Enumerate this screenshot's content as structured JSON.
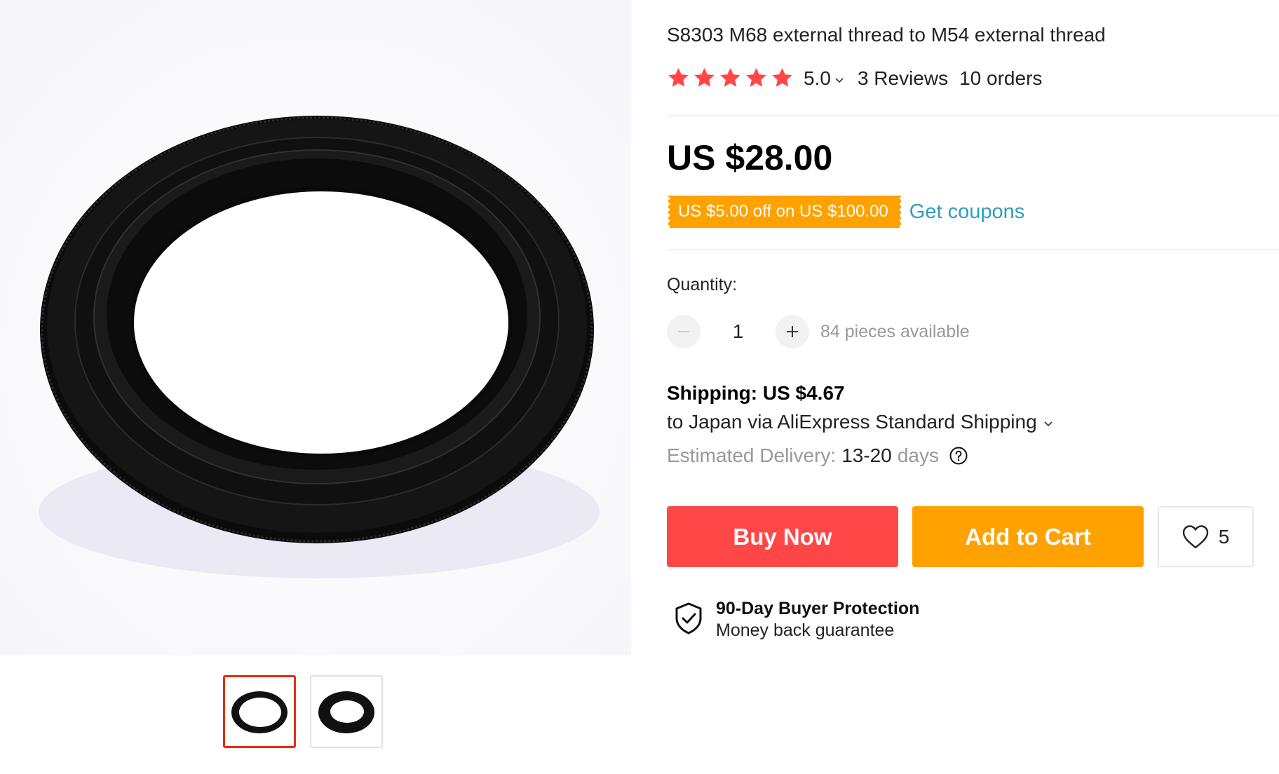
{
  "product": {
    "title": "S8303 M68 external thread to M54 external thread",
    "rating": "5.0",
    "star_count": 5,
    "reviews": "3 Reviews",
    "orders": "10 orders",
    "price": "US $28.00",
    "coupon_text": "US $5.00 off on US $100.00",
    "get_coupons_label": "Get coupons"
  },
  "quantity": {
    "label": "Quantity:",
    "value": "1",
    "stock": "84 pieces available"
  },
  "shipping": {
    "line1": "Shipping: US $4.67",
    "line2": "to Japan via AliExpress Standard Shipping",
    "delivery_label": "Estimated Delivery:",
    "delivery_range": "13-20",
    "delivery_unit": "days"
  },
  "actions": {
    "buy_now": "Buy Now",
    "add_to_cart": "Add to Cart",
    "wishlist_count": "5"
  },
  "protection": {
    "title": "90-Day Buyer Protection",
    "subtitle": "Money back guarantee"
  },
  "gallery": {
    "thumbnails": [
      "thumb-1",
      "thumb-2"
    ],
    "active_index": 0
  },
  "colors": {
    "star": "#ff4747",
    "buy_now": "#ff4747",
    "add_to_cart": "#ffa200",
    "coupon": "#ffa200",
    "link": "#2e9cc3",
    "active_thumb_border": "#e62e04"
  },
  "icons": {
    "star": "star-icon",
    "caret": "chevron-down-icon",
    "help": "question-circle-icon",
    "heart": "heart-icon",
    "shield": "shield-check-icon"
  }
}
